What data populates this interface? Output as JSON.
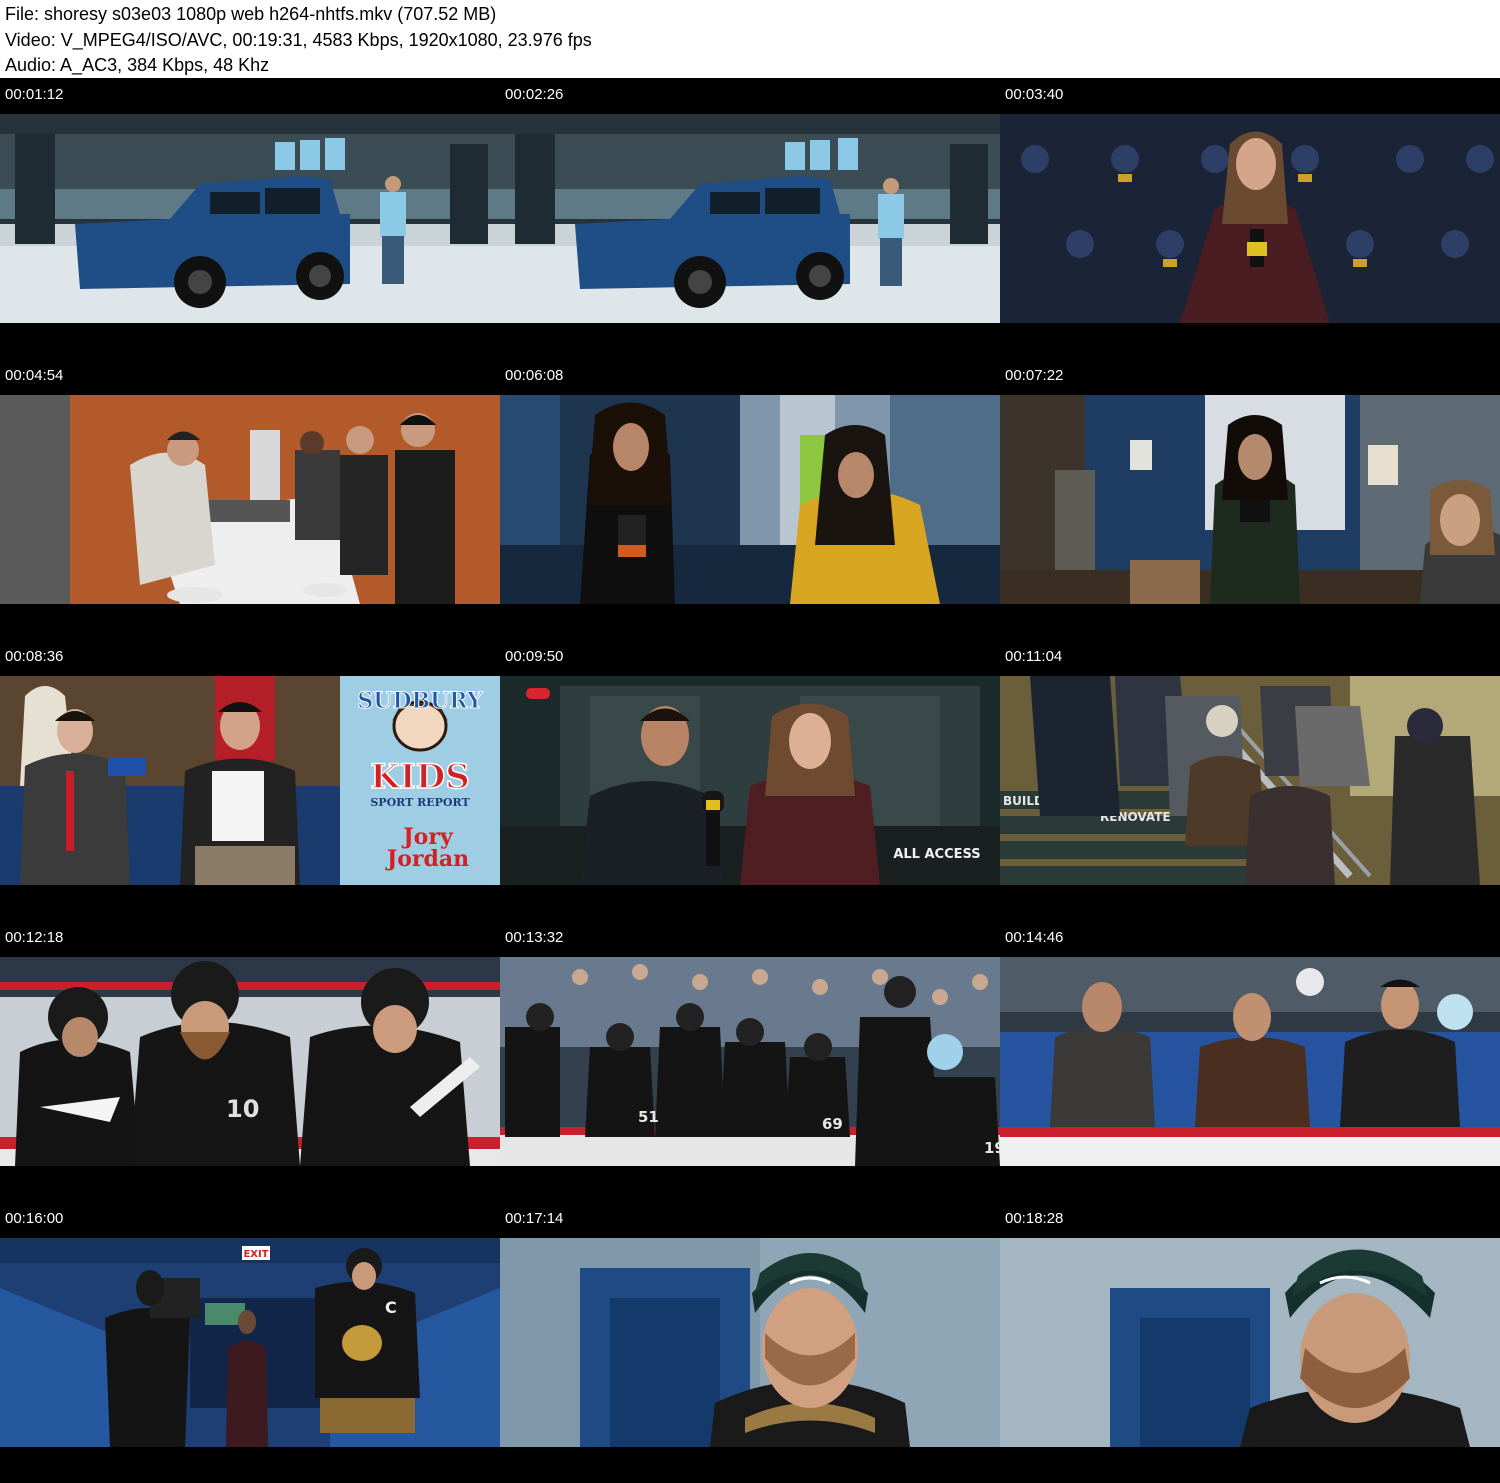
{
  "header": {
    "file_line": "File: shoresy s03e03 1080p web h264-nhtfs.mkv (707.52 MB)",
    "video_line": "Video: V_MPEG4/ISO/AVC, 00:19:31, 4583 Kbps, 1920x1080, 23.976 fps",
    "audio_line": "Audio: A_AC3, 384 Kbps, 48 Khz"
  },
  "thumbnails": [
    {
      "timestamp": "00:01:12",
      "scene": "truck"
    },
    {
      "timestamp": "00:02:26",
      "scene": "truck"
    },
    {
      "timestamp": "00:03:40",
      "scene": "presenter"
    },
    {
      "timestamp": "00:04:54",
      "scene": "kitchen"
    },
    {
      "timestamp": "00:06:08",
      "scene": "hallway"
    },
    {
      "timestamp": "00:07:22",
      "scene": "office"
    },
    {
      "timestamp": "00:08:36",
      "scene": "kids-report",
      "signage": [
        "SUDBURY",
        "KIDS",
        "SPORT REPORT",
        "Jory",
        "Jordan"
      ]
    },
    {
      "timestamp": "00:09:50",
      "scene": "interview",
      "signage": [
        "ALL ACCESS"
      ]
    },
    {
      "timestamp": "00:11:04",
      "scene": "stairs",
      "signage": [
        "BUILD",
        "RENOVATE"
      ]
    },
    {
      "timestamp": "00:12:18",
      "scene": "bench-close",
      "signage": [
        "10"
      ]
    },
    {
      "timestamp": "00:13:32",
      "scene": "bench-wide",
      "signage": [
        "51",
        "69",
        "19"
      ]
    },
    {
      "timestamp": "00:14:46",
      "scene": "stands"
    },
    {
      "timestamp": "00:16:00",
      "scene": "tunnel",
      "signage": [
        "EXIT",
        "C"
      ]
    },
    {
      "timestamp": "00:17:14",
      "scene": "closeup"
    },
    {
      "timestamp": "00:18:28",
      "scene": "closeup"
    }
  ],
  "colors": {
    "header_bg": "#ffffff",
    "sheet_bg": "#000000",
    "timestamp_text": "#ffffff",
    "jersey_blue": "#8cc9e6",
    "truck_blue": "#1f4d86",
    "board_red": "#c8202c"
  }
}
